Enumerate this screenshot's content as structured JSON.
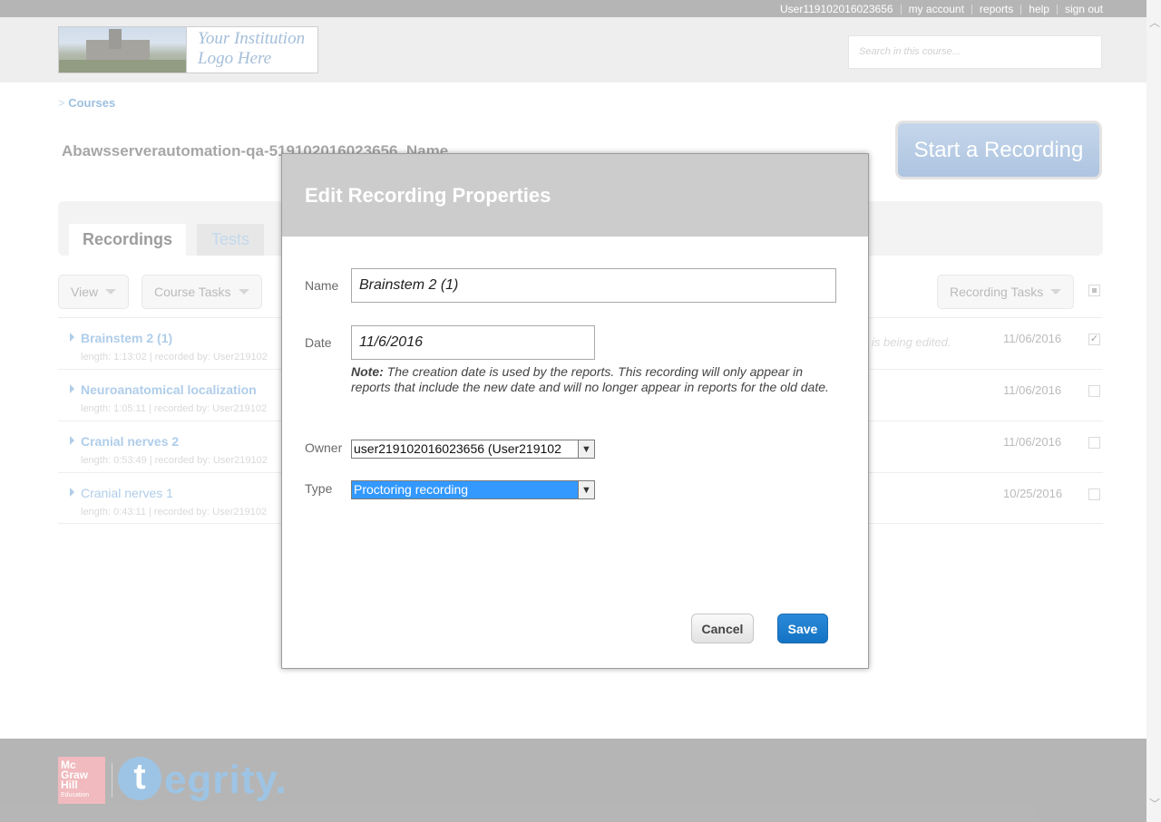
{
  "topbar": {
    "user": "User11910201602365​6",
    "my_account": "my account",
    "reports": "reports",
    "help": "help",
    "sign_out": "sign out"
  },
  "header": {
    "logo_line1": "Your Institution",
    "logo_line2": "Logo Here",
    "search_placeholder": "Search in this course..."
  },
  "breadcrumb": {
    "prefix": ">",
    "link": "Courses"
  },
  "course": {
    "title": "Abawsserverautomation-qa-519102016023656_Name"
  },
  "start_recording": "Start a Recording",
  "tabs": [
    {
      "label": "Recordings"
    },
    {
      "label": "Tests"
    }
  ],
  "toolbar": {
    "view": "View",
    "course_tasks": "Course Tasks",
    "recording_tasks": "Recording Tasks"
  },
  "recordings": [
    {
      "name": "Brainstem 2 (1)",
      "meta": "length: 1:13:02 | recorded by: User219102",
      "status": "is being edited.",
      "date": "11/06/2016",
      "checked": "✓"
    },
    {
      "name": "Neuroanatomical localization",
      "meta": "length: 1:05:11 | recorded by: User219102",
      "status": "",
      "date": "11/06/2016",
      "checked": ""
    },
    {
      "name": "Cranial nerves 2",
      "meta": "length: 0:53:49 | recorded by: User219102",
      "status": "",
      "date": "11/06/2016",
      "checked": ""
    },
    {
      "name": "Cranial nerves 1",
      "meta": "length: 0:43:11 | recorded by: User219102",
      "status": "",
      "date": "10/25/2016",
      "checked": ""
    }
  ],
  "footer": {
    "mh_line1": "Mc",
    "mh_line2": "Graw",
    "mh_line3": "Hill",
    "mh_line4": "Education",
    "tegrity_t": "t",
    "tegrity_rest": "egrity."
  },
  "modal": {
    "title": "Edit Recording Properties",
    "name_label": "Name",
    "name_value": "Brainstem 2 (1)",
    "date_label": "Date",
    "date_value": "11/6/2016",
    "note_bold": "Note:",
    "note_text": " The creation date is used by the reports. This recording will only appear in reports that include the new date and will no longer appear in reports for the old date.",
    "owner_label": "Owner",
    "owner_value": "user219102016023656 (User219102",
    "type_label": "Type",
    "type_value": "Proctoring recording",
    "cancel": "Cancel",
    "save": "Save"
  }
}
